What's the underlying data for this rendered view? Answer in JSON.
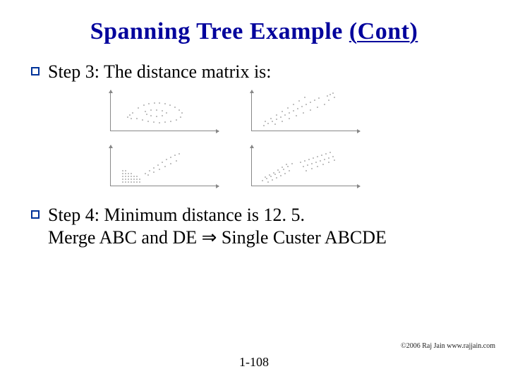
{
  "title": {
    "plain": "Spanning Tree Example ",
    "underlined": "(Cont)"
  },
  "step3": {
    "text": "Step 3: The distance matrix is:"
  },
  "step4": {
    "line1": "Step 4: Minimum distance is 12. 5.",
    "line2_pre": "Merge ABC and DE ",
    "implies_glyph": "⇒",
    "line2_post": " Single Custer ABCDE"
  },
  "footer": {
    "page": "1-108",
    "copyright": "©2006 Raj Jain www.rajjain.com"
  }
}
